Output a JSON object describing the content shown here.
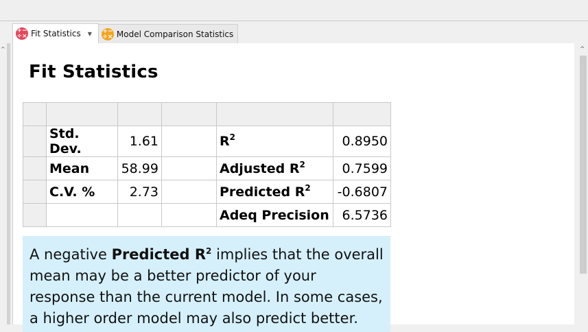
{
  "tabs": [
    {
      "label": "Fit Statistics",
      "icon": "fit-statistics-icon",
      "active": true
    },
    {
      "label": "Model Comparison Statistics",
      "icon": "model-comparison-icon",
      "active": false
    }
  ],
  "page_title": "Fit Statistics",
  "fit_stats": {
    "left": [
      {
        "label": "Std. Dev.",
        "value": "1.61"
      },
      {
        "label": "Mean",
        "value": "58.99"
      },
      {
        "label": "C.V. %",
        "value": "2.73"
      }
    ],
    "right": [
      {
        "label": "R",
        "sup": "2",
        "value": "0.8950"
      },
      {
        "label": "Adjusted R",
        "sup": "2",
        "value": "0.7599"
      },
      {
        "label": "Predicted R",
        "sup": "2",
        "value": "-0.6807"
      },
      {
        "label": "Adeq Precision",
        "sup": "",
        "value": "6.5736"
      }
    ]
  },
  "note": {
    "prefix": "A negative ",
    "bold": "Predicted R",
    "bold_sup": "2",
    "suffix": " implies that the overall mean may be a better predictor of your response than the current model. In some cases, a higher order model may also predict better."
  },
  "colors": {
    "note_bg": "#d5f0fb",
    "tab_icon_red": "#e3465c",
    "tab_icon_orange": "#f2a522"
  }
}
